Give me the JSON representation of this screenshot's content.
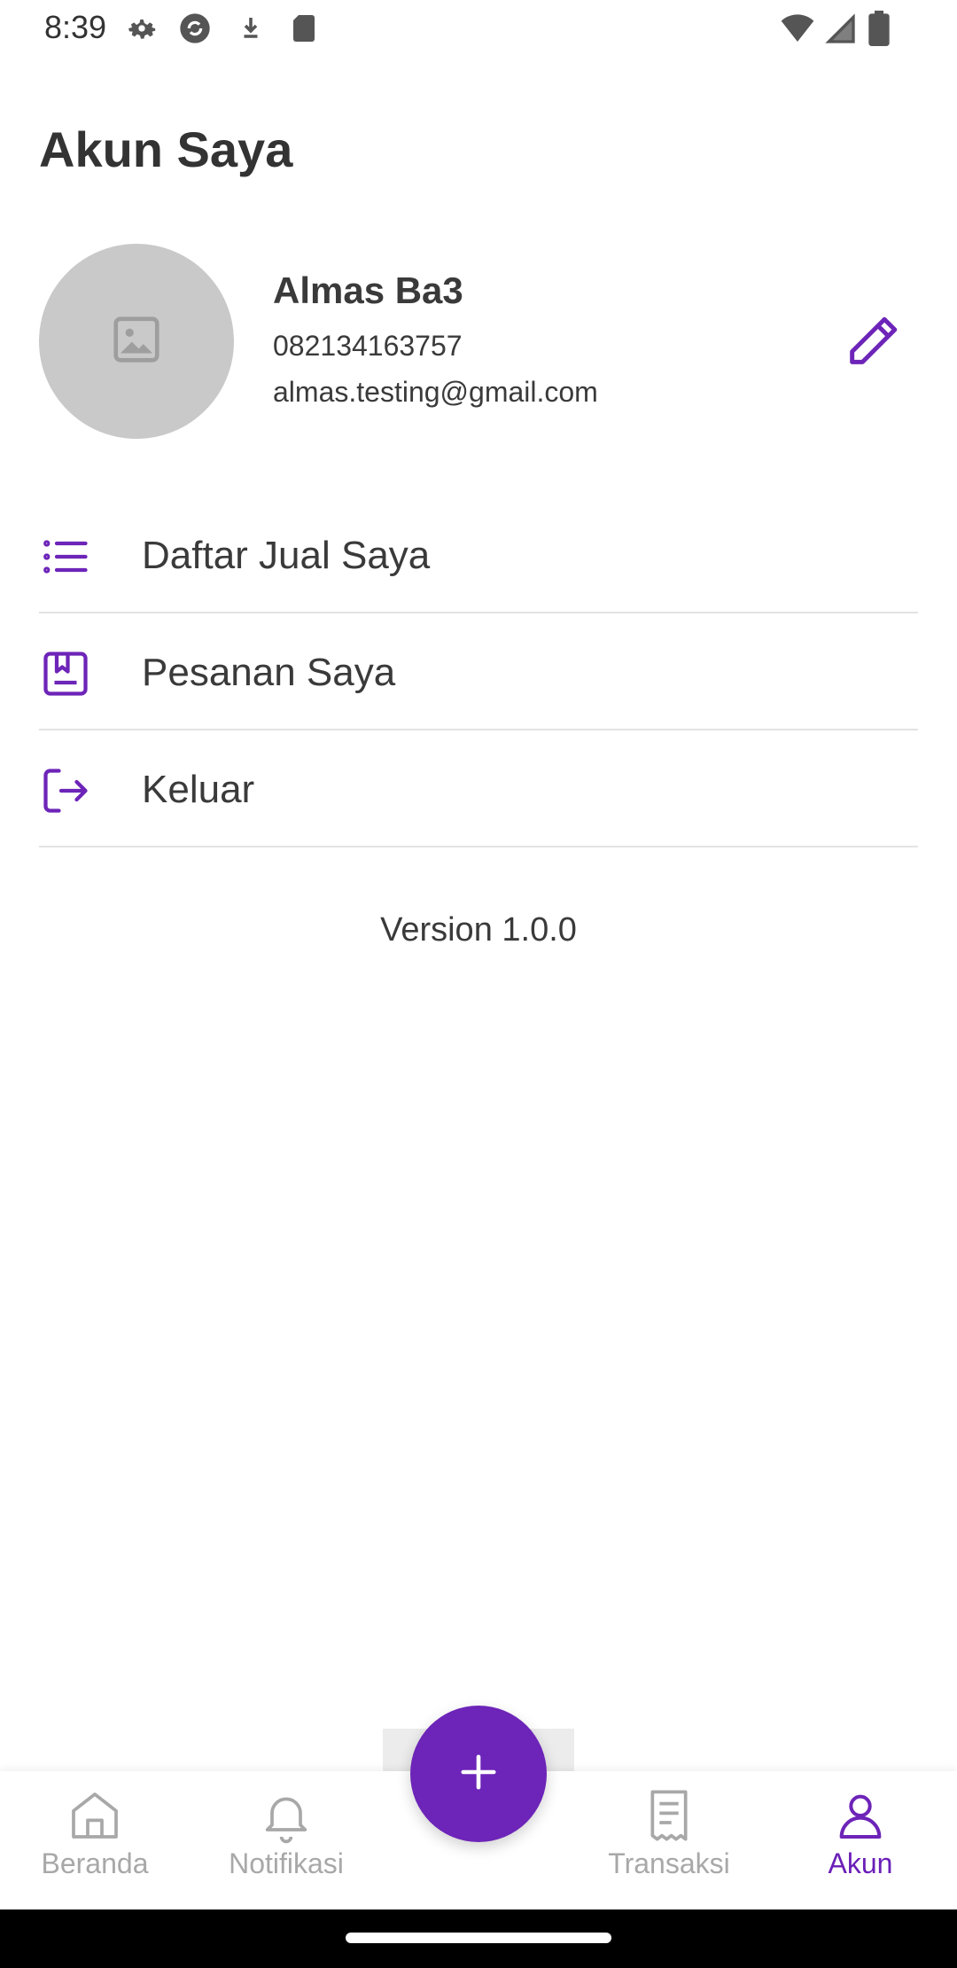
{
  "status_bar": {
    "time": "8:39",
    "left_icons": [
      "settings-icon",
      "sync-icon",
      "download-icon",
      "sd-card-icon"
    ],
    "right_icons": [
      "wifi-icon",
      "signal-icon",
      "battery-icon"
    ]
  },
  "page": {
    "title": "Akun Saya"
  },
  "profile": {
    "avatar_icon": "image-placeholder-icon",
    "name": "Almas Ba3",
    "phone": "082134163757",
    "email": "almas.testing@gmail.com",
    "edit_icon": "pencil-icon"
  },
  "menu": [
    {
      "label": "Daftar Jual Saya",
      "icon": "list-icon"
    },
    {
      "label": "Pesanan Saya",
      "icon": "bookmark-book-icon"
    },
    {
      "label": "Keluar",
      "icon": "logout-icon"
    }
  ],
  "version": "Version 1.0.0",
  "bottom_nav": {
    "items": [
      {
        "label": "Beranda",
        "icon": "home-icon"
      },
      {
        "label": "Notifikasi",
        "icon": "bell-icon"
      },
      {
        "label": "Transaksi",
        "icon": "receipt-icon"
      },
      {
        "label": "Akun",
        "icon": "user-icon",
        "active": true
      }
    ],
    "fab_icon": "plus-icon"
  },
  "colors": {
    "accent": "#6d24b8",
    "accent_text": "#6a1fb8",
    "inactive": "#a8a8a8",
    "avatar_bg": "#c9c9c9"
  }
}
